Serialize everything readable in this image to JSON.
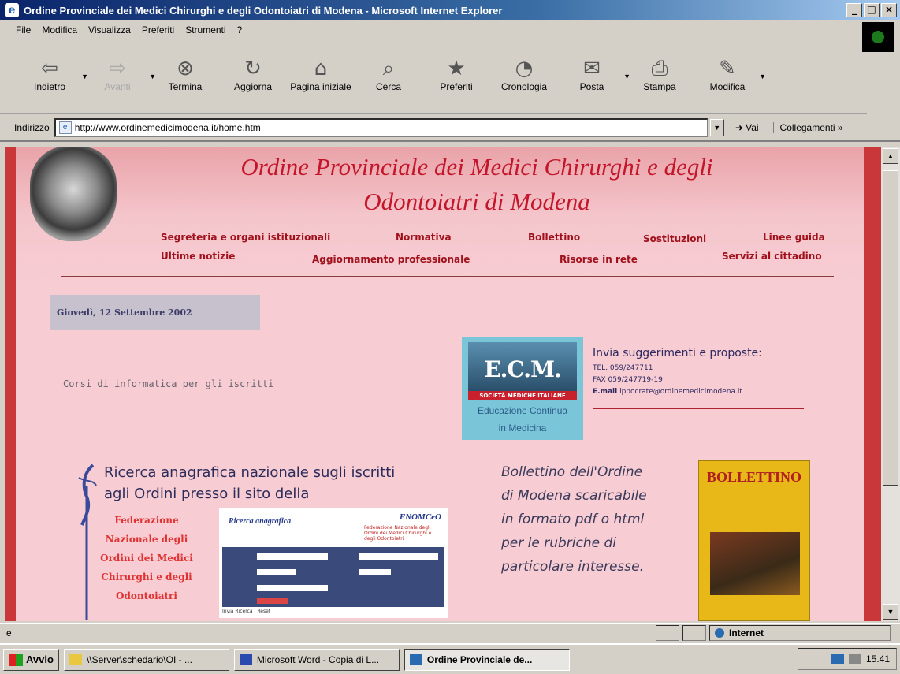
{
  "window": {
    "title": "Ordine Provinciale dei Medici Chirurghi e degli Odontoiatri di Modena - Microsoft Internet Explorer",
    "controls": [
      "_",
      "□",
      "×"
    ]
  },
  "menu": [
    "File",
    "Modifica",
    "Visualizza",
    "Preferiti",
    "Strumenti",
    "?"
  ],
  "toolbar": [
    {
      "label": "Indietro",
      "icon": "back-arrow-icon",
      "glyph": "⇦",
      "disabled": false,
      "dropdown": true
    },
    {
      "label": "Avanti",
      "icon": "forward-arrow-icon",
      "glyph": "⇨",
      "disabled": true,
      "dropdown": true
    },
    {
      "label": "Termina",
      "icon": "stop-icon",
      "glyph": "⊗",
      "disabled": false,
      "dropdown": false
    },
    {
      "label": "Aggiorna",
      "icon": "refresh-icon",
      "glyph": "↻",
      "disabled": false,
      "dropdown": false
    },
    {
      "label": "Pagina iniziale",
      "icon": "home-icon",
      "glyph": "⌂",
      "disabled": false,
      "dropdown": false
    },
    {
      "label": "Cerca",
      "icon": "search-icon",
      "glyph": "⌕",
      "disabled": false,
      "dropdown": false
    },
    {
      "label": "Preferiti",
      "icon": "favorites-icon",
      "glyph": "★",
      "disabled": false,
      "dropdown": false
    },
    {
      "label": "Cronologia",
      "icon": "history-icon",
      "glyph": "◔",
      "disabled": false,
      "dropdown": false
    },
    {
      "label": "Posta",
      "icon": "mail-icon",
      "glyph": "✉",
      "disabled": false,
      "dropdown": true
    },
    {
      "label": "Stampa",
      "icon": "print-icon",
      "glyph": "⎙",
      "disabled": false,
      "dropdown": false
    },
    {
      "label": "Modifica",
      "icon": "edit-icon",
      "glyph": "✎",
      "disabled": false,
      "dropdown": true
    }
  ],
  "address": {
    "label": "Indirizzo",
    "url": "http://www.ordinemedicimodena.it/home.htm",
    "go_label": "Vai",
    "links_label": "Collegamenti »"
  },
  "site": {
    "title_line1": "Ordine Provinciale dei Medici Chirurghi e degli",
    "title_line2": "Odontoiatri di Modena",
    "nav_row1": [
      "Segreteria e organi istituzionali",
      "Normativa",
      "Bollettino",
      "Sostituzioni",
      "Linee guida"
    ],
    "nav_row2": [
      "Ultime notizie",
      "Aggiornamento professionale",
      "Risorse in rete",
      "Servizi al cittadino"
    ],
    "date": "Giovedì, 12 Settembre 2002",
    "corsi_link": "Corsi di informatica per gli iscritti",
    "ecm": {
      "logo_text": "E.C.M.",
      "band": "SOCIETÀ MEDICHE ITALIANE",
      "caption_line1": "Educazione Continua",
      "caption_line2": "in Medicina"
    },
    "contact": {
      "heading": "Invia suggerimenti e proposte:",
      "tel": "TEL. 059/247711",
      "fax": "FAX 059/247719-19",
      "email_label": "E.mail",
      "email": "ippocrate@ordinemedicimodena.it"
    },
    "ricerca": {
      "line1": "Ricerca anagrafica nazionale sugli iscritti",
      "line2": "agli Ordini presso il sito della",
      "federazione": [
        "Federazione",
        "Nazionale degli",
        "Ordini dei Medici",
        "Chirurghi e degli",
        "Odontoiatri"
      ]
    },
    "fnomceo": {
      "title": "Ricerca anagrafica",
      "logo": "FNOMCeO",
      "subtitle": "Federazione Nazionale degli Ordini dei Medici Chirurghi e degli Odontoiatri",
      "buttons": "Invia Ricerca | Reset"
    },
    "bollettino": {
      "text_lines": [
        "Bollettino dell'Ordine",
        "di Modena scaricabile",
        "in formato pdf o html",
        "per le rubriche di",
        "particolare interesse."
      ],
      "cover_title": "BOLLETTINO"
    }
  },
  "status": {
    "zone": "Internet"
  },
  "taskbar": {
    "start": "Avvio",
    "tasks": [
      {
        "label": "\\\\Server\\schedario\\OI - ...",
        "icon": "folder-icon",
        "color": "#e8c840",
        "active": false
      },
      {
        "label": "Microsoft Word - Copia di L...",
        "icon": "word-icon",
        "color": "#2a4ab0",
        "active": false
      },
      {
        "label": "Ordine Provinciale de...",
        "icon": "ie-icon",
        "color": "#2a6ab0",
        "active": true
      }
    ],
    "clock": "15.41"
  },
  "colors": {
    "accent_red": "#c3162b",
    "page_pink": "#f7cdd3",
    "frame_red": "#c9373a"
  }
}
